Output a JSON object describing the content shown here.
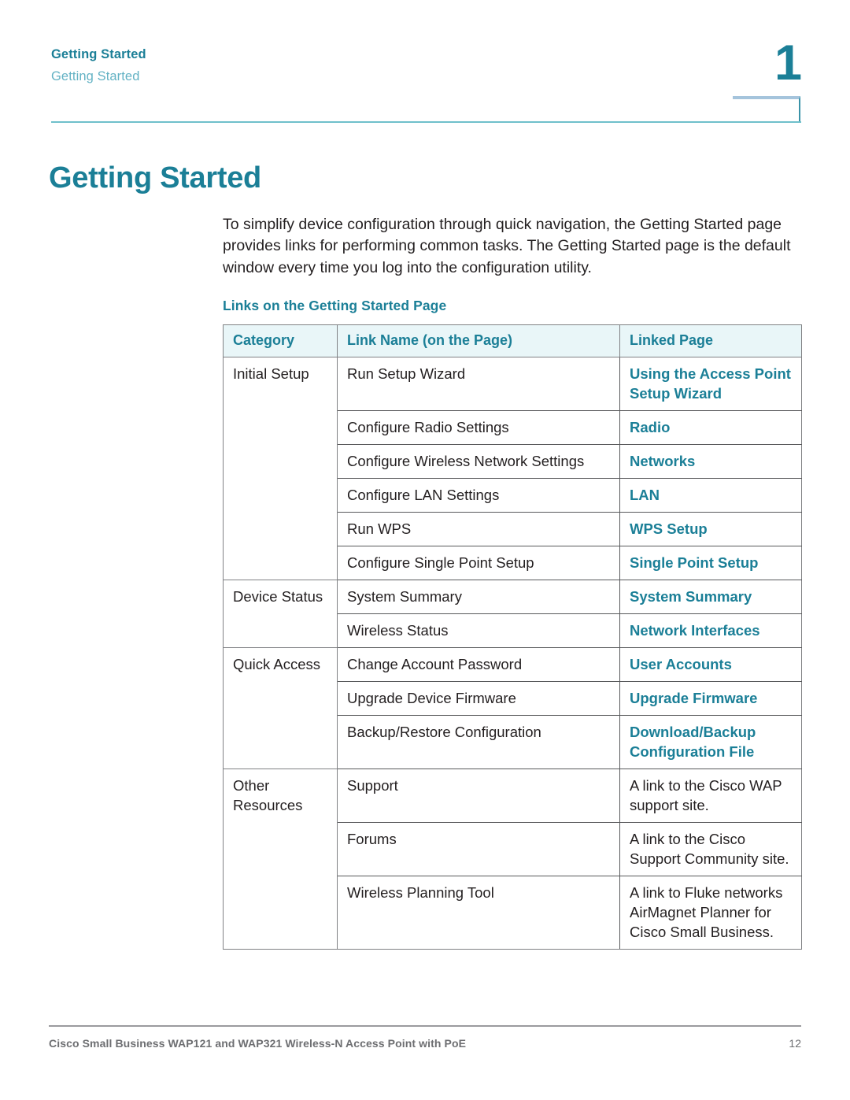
{
  "header": {
    "chapter_title": "Getting Started",
    "section_title": "Getting Started",
    "chapter_number": "1"
  },
  "page_title": "Getting Started",
  "intro_paragraph": "To simplify device configuration through quick navigation, the Getting Started page provides links for performing common tasks. The Getting Started page is the default window every time you log into the configuration utility.",
  "table_heading": "Links on the Getting Started Page",
  "table": {
    "columns": [
      "Category",
      "Link Name (on the Page)",
      "Linked Page"
    ],
    "groups": [
      {
        "category": "Initial Setup",
        "rows": [
          {
            "link_name": "Run Setup Wizard",
            "linked_page": "Using the Access Point Setup Wizard",
            "is_xref": true
          },
          {
            "link_name": "Configure Radio Settings",
            "linked_page": "Radio",
            "is_xref": true
          },
          {
            "link_name": "Configure Wireless Network Settings",
            "linked_page": "Networks",
            "is_xref": true
          },
          {
            "link_name": "Configure LAN Settings",
            "linked_page": "LAN",
            "is_xref": true
          },
          {
            "link_name": "Run WPS",
            "linked_page": "WPS Setup",
            "is_xref": true
          },
          {
            "link_name": "Configure Single Point Setup",
            "linked_page": "Single Point Setup",
            "is_xref": true
          }
        ]
      },
      {
        "category": "Device Status",
        "rows": [
          {
            "link_name": "System Summary",
            "linked_page": "System Summary",
            "is_xref": true
          },
          {
            "link_name": "Wireless Status",
            "linked_page": "Network Interfaces",
            "is_xref": true
          }
        ]
      },
      {
        "category": "Quick Access",
        "rows": [
          {
            "link_name": "Change Account Password",
            "linked_page": "User Accounts",
            "is_xref": true
          },
          {
            "link_name": "Upgrade Device Firmware",
            "linked_page": "Upgrade Firmware",
            "is_xref": true
          },
          {
            "link_name": "Backup/Restore Configuration",
            "linked_page": "Download/Backup Configuration File",
            "is_xref": true
          }
        ]
      },
      {
        "category": "Other Resources",
        "rows": [
          {
            "link_name": "Support",
            "linked_page": "A link to the Cisco WAP support site.",
            "is_xref": false
          },
          {
            "link_name": "Forums",
            "linked_page": "A link to the Cisco Support Community site.",
            "is_xref": false
          },
          {
            "link_name": "Wireless Planning Tool",
            "linked_page": "A link to Fluke networks AirMagnet Planner for Cisco Small Business.",
            "is_xref": false
          }
        ]
      }
    ]
  },
  "footer": {
    "document_title": "Cisco Small Business WAP121 and WAP321 Wireless-N Access Point with PoE",
    "page_number": "12"
  },
  "colors": {
    "accent_teal": "#1b7f97",
    "light_teal": "#63b2c4",
    "rule_teal": "#6fc0cb",
    "header_fill": "#e9f6f8",
    "box_top": "#a5c4dc",
    "body_text": "#231f20",
    "footer_gray": "#6d6e71"
  }
}
